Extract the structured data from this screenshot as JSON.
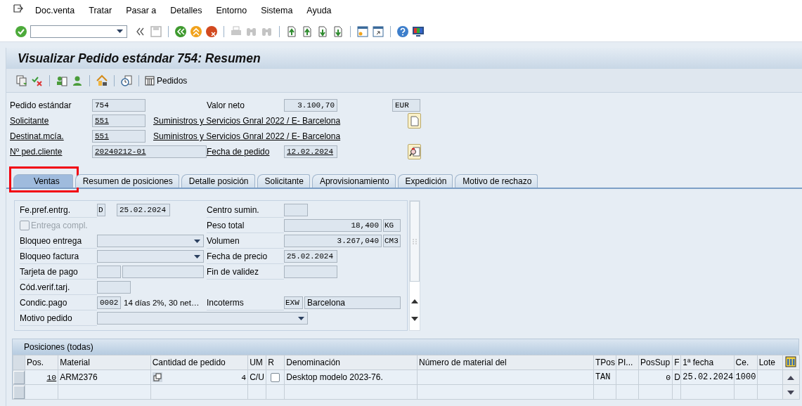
{
  "menu": [
    "Doc.venta",
    "Tratar",
    "Pasar a",
    "Detalles",
    "Entorno",
    "Sistema",
    "Ayuda"
  ],
  "title": "Visualizar Pedido estándar 754: Resumen",
  "app_toolbar": {
    "orders_button": "Pedidos"
  },
  "header": {
    "order": {
      "label": "Pedido estándar",
      "value": "754"
    },
    "net_value": {
      "label": "Valor neto",
      "value": "3.100,70",
      "currency": "EUR"
    },
    "sold_to": {
      "label": "Solicitante",
      "value": "551",
      "description": "Suministros y Servicios Gnral 2022 / E- Barcelona"
    },
    "ship_to": {
      "label": "Destinat.mcía.",
      "value": "551",
      "description": "Suministros y Servicios Gnral 2022 / E- Barcelona"
    },
    "customer_ref": {
      "label": "Nº ped.cliente",
      "value": "20240212-01"
    },
    "order_date": {
      "label": "Fecha de pedido",
      "value": "12.02.2024"
    }
  },
  "tabs": [
    {
      "label": "Ventas",
      "selected": true,
      "highlighted": true
    },
    {
      "label": "Resumen de posiciones",
      "selected": false,
      "highlighted": false
    },
    {
      "label": "Detalle posición",
      "selected": false,
      "highlighted": false
    },
    {
      "label": "Solicitante",
      "selected": false,
      "highlighted": false
    },
    {
      "label": "Aprovisionamiento",
      "selected": false,
      "highlighted": false
    },
    {
      "label": "Expedición",
      "selected": false,
      "highlighted": false
    },
    {
      "label": "Motivo de rechazo",
      "selected": false,
      "highlighted": false
    }
  ],
  "sales": {
    "delivery_date": {
      "label": "Fe.pref.entrg.",
      "type": "D",
      "value": "25.02.2024"
    },
    "complete_delivery": {
      "label": "Entrega compl.",
      "checked": false,
      "disabled": true
    },
    "delivery_block": {
      "label": "Bloqueo entrega"
    },
    "billing_block": {
      "label": "Bloqueo factura"
    },
    "payment_card": {
      "label": "Tarjeta de pago"
    },
    "card_verification": {
      "label": "Cód.verif.tarj."
    },
    "payment_terms": {
      "label": "Condic.pago",
      "value": "0002",
      "description": "14 días 2%, 30 net…"
    },
    "order_reason": {
      "label": "Motivo pedido"
    },
    "delivering_plant": {
      "label": "Centro sumin."
    },
    "total_weight": {
      "label": "Peso total",
      "value": "18,400",
      "unit": "KG"
    },
    "volume": {
      "label": "Volumen",
      "value": "3.267,040",
      "unit": "CM3"
    },
    "pricing_date": {
      "label": "Fecha de precio",
      "value": "25.02.2024"
    },
    "valid_to": {
      "label": "Fin de validez"
    },
    "incoterms": {
      "label": "Incoterms",
      "value": "EXW",
      "location": "Barcelona"
    }
  },
  "table": {
    "title": "Posiciones (todas)",
    "columns": [
      {
        "label": "Pos.",
        "kind": "num"
      },
      {
        "label": "Material",
        "kind": "text"
      },
      {
        "label": "Cantidad de pedido",
        "kind": "qty"
      },
      {
        "label": "UM",
        "kind": "text"
      },
      {
        "label": "R",
        "kind": "check"
      },
      {
        "label": "Denominación",
        "kind": "text"
      },
      {
        "label": "Número de material del",
        "kind": "text"
      },
      {
        "label": "TPos",
        "kind": "text"
      },
      {
        "label": "PI...",
        "kind": "text"
      },
      {
        "label": "PosSup",
        "kind": "num"
      },
      {
        "label": "F",
        "kind": "text"
      },
      {
        "label": "1ª fecha",
        "kind": "text"
      },
      {
        "label": "Ce.",
        "kind": "text"
      },
      {
        "label": "Lote",
        "kind": "text"
      }
    ],
    "rows": [
      {
        "selected": false,
        "cells": [
          "10",
          "ARM2376",
          "4",
          "C/U",
          false,
          "Desktop modelo 2023-76.",
          null,
          "TAN",
          null,
          "0",
          "D",
          "25.02.2024",
          "1000",
          null
        ]
      }
    ]
  }
}
